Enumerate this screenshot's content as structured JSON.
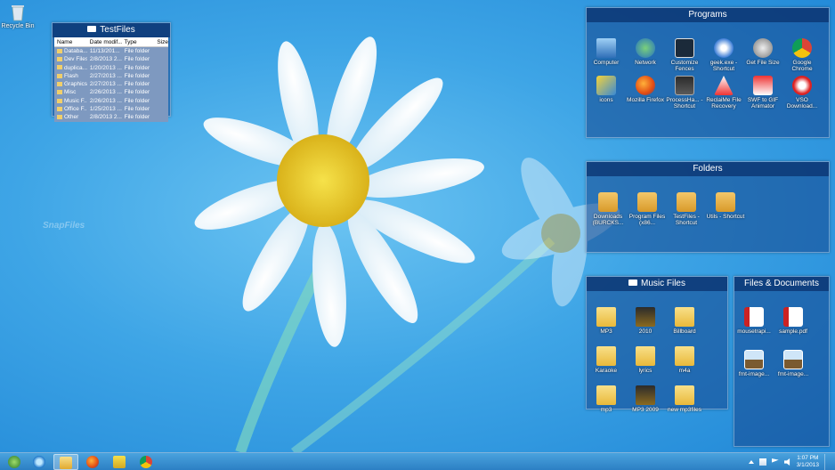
{
  "desktop": {
    "recycle_bin_label": "Recycle Bin",
    "watermark": "SnapFiles"
  },
  "testfiles_fence": {
    "title": "TestFiles",
    "columns": [
      "Name",
      "Date modif...",
      "Type",
      "Size"
    ],
    "rows": [
      {
        "name": "Databa...",
        "date": "11/13/201...",
        "type": "File folder"
      },
      {
        "name": "Dev Files",
        "date": "2/8/2013 2...",
        "type": "File folder"
      },
      {
        "name": "duplica...",
        "date": "1/20/2013 ...",
        "type": "File folder"
      },
      {
        "name": "Flash",
        "date": "2/27/2013 ...",
        "type": "File folder"
      },
      {
        "name": "Graphics",
        "date": "2/27/2013 ...",
        "type": "File folder"
      },
      {
        "name": "Misc",
        "date": "2/26/2013 ...",
        "type": "File folder"
      },
      {
        "name": "Music F...",
        "date": "2/26/2013 ...",
        "type": "File folder"
      },
      {
        "name": "Office F...",
        "date": "1/25/2013 ...",
        "type": "File folder"
      },
      {
        "name": "Other",
        "date": "2/8/2013 2...",
        "type": "File folder"
      }
    ]
  },
  "programs_fence": {
    "title": "Programs",
    "items": [
      {
        "label": "Computer",
        "icon": "pc"
      },
      {
        "label": "Network",
        "icon": "net"
      },
      {
        "label": "Customize Fences",
        "icon": "fences"
      },
      {
        "label": "geek.exe - Shortcut",
        "icon": "geek"
      },
      {
        "label": "Get File Size",
        "icon": "getsize"
      },
      {
        "label": "Google Chrome",
        "icon": "chrome"
      },
      {
        "label": "icons",
        "icon": "icons-i"
      },
      {
        "label": "Mozilla Firefox",
        "icon": "firefox"
      },
      {
        "label": "ProcessHa... - Shortcut",
        "icon": "prochacker"
      },
      {
        "label": "ReclaiMe File Recovery",
        "icon": "reclaim"
      },
      {
        "label": "SWF to GIF Animator",
        "icon": "swf"
      },
      {
        "label": "VSO Download...",
        "icon": "vso"
      }
    ]
  },
  "folders_fence": {
    "title": "Folders",
    "items": [
      {
        "label": "Downloads (BURCKS...",
        "icon": "shortcut"
      },
      {
        "label": "Program Files (x86...",
        "icon": "shortcut"
      },
      {
        "label": "TestFiles - Shortcut",
        "icon": "shortcut"
      },
      {
        "label": "Utils - Shortcut",
        "icon": "shortcut"
      }
    ]
  },
  "music_fence": {
    "title": "Music Files",
    "items": [
      {
        "label": "MP3",
        "icon": "folder"
      },
      {
        "label": "2010",
        "icon": "folder-dark"
      },
      {
        "label": "Billboard",
        "icon": "folder"
      },
      {
        "label": "Karaoke",
        "icon": "folder"
      },
      {
        "label": "lyrics",
        "icon": "folder"
      },
      {
        "label": "m4a",
        "icon": "folder"
      },
      {
        "label": "mp3",
        "icon": "folder"
      },
      {
        "label": "MP3 2009",
        "icon": "folder-dark"
      },
      {
        "label": "new mp3files",
        "icon": "folder"
      }
    ]
  },
  "docs_fence": {
    "title": "Files & Documents",
    "items": [
      {
        "label": "mousetrapi...",
        "icon": "pdf"
      },
      {
        "label": "sample.pdf",
        "icon": "pdf"
      },
      {
        "label": "fmt-image...",
        "icon": "img"
      },
      {
        "label": "fmt-image...",
        "icon": "img"
      }
    ]
  },
  "taskbar": {
    "apps": [
      "start",
      "internet-explorer",
      "file-explorer",
      "firefox",
      "folder-app",
      "chrome"
    ],
    "clock_time": "1:07 PM",
    "clock_date": "3/1/2013"
  }
}
